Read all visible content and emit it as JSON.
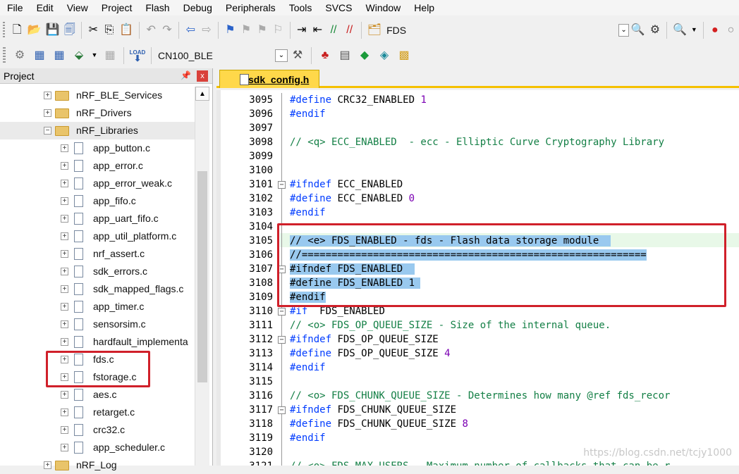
{
  "menu": [
    "File",
    "Edit",
    "View",
    "Project",
    "Flash",
    "Debug",
    "Peripherals",
    "Tools",
    "SVCS",
    "Window",
    "Help"
  ],
  "toolbar1": {
    "icons": [
      "new-file-icon",
      "open-file-icon",
      "save-icon",
      "save-all-icon",
      "cut-icon",
      "copy-icon",
      "paste-icon",
      "undo-icon",
      "redo-icon",
      "back-icon",
      "forward-icon",
      "bookmark-icon",
      "prev-bookmark-icon",
      "next-bookmark-icon",
      "clear-bookmarks-icon",
      "indent-icon",
      "unindent-icon",
      "comment-icon",
      "uncomment-icon",
      "find-in-files-icon"
    ],
    "find_text": "FDS",
    "right_icons": [
      "dropdown-icon",
      "browse-icon",
      "debug-session-icon",
      "zoom-icon",
      "breakpoint-icon",
      "stop-icon"
    ]
  },
  "toolbar2": {
    "target": "CN100_BLE",
    "load_label": "LOAD"
  },
  "project_panel": {
    "title": "Project",
    "pin": "\u0004",
    "close": "x",
    "items": [
      {
        "label": "nRF_BLE_Services",
        "kind": "folder",
        "exp": "+"
      },
      {
        "label": "nRF_Drivers",
        "kind": "folder",
        "exp": "+"
      },
      {
        "label": "nRF_Libraries",
        "kind": "folder",
        "exp": "−"
      },
      {
        "label": "app_button.c",
        "kind": "file",
        "exp": "+"
      },
      {
        "label": "app_error.c",
        "kind": "file",
        "exp": "+"
      },
      {
        "label": "app_error_weak.c",
        "kind": "file",
        "exp": "+"
      },
      {
        "label": "app_fifo.c",
        "kind": "file",
        "exp": "+"
      },
      {
        "label": "app_uart_fifo.c",
        "kind": "file",
        "exp": "+"
      },
      {
        "label": "app_util_platform.c",
        "kind": "file",
        "exp": "+"
      },
      {
        "label": "nrf_assert.c",
        "kind": "file",
        "exp": "+"
      },
      {
        "label": "sdk_errors.c",
        "kind": "file",
        "exp": "+"
      },
      {
        "label": "sdk_mapped_flags.c",
        "kind": "file",
        "exp": "+"
      },
      {
        "label": "app_timer.c",
        "kind": "file",
        "exp": "+"
      },
      {
        "label": "sensorsim.c",
        "kind": "file",
        "exp": "+"
      },
      {
        "label": "hardfault_implementa",
        "kind": "file",
        "exp": "+"
      },
      {
        "label": "fds.c",
        "kind": "file",
        "exp": "+"
      },
      {
        "label": "fstorage.c",
        "kind": "file",
        "exp": "+"
      },
      {
        "label": "aes.c",
        "kind": "file",
        "exp": "+"
      },
      {
        "label": "retarget.c",
        "kind": "file",
        "exp": "+"
      },
      {
        "label": "crc32.c",
        "kind": "file",
        "exp": "+"
      },
      {
        "label": "app_scheduler.c",
        "kind": "file",
        "exp": "+"
      },
      {
        "label": "nRF_Log",
        "kind": "folder",
        "exp": "+"
      }
    ]
  },
  "editor": {
    "tab": "sdk_config.h",
    "lines": [
      {
        "n": "3095",
        "code": [
          [
            "pp",
            "#define "
          ],
          [
            "id",
            "CRC32_ENABLED "
          ],
          [
            "nm",
            "1"
          ]
        ]
      },
      {
        "n": "3096",
        "code": [
          [
            "pp",
            "#endif"
          ]
        ]
      },
      {
        "n": "3097",
        "code": []
      },
      {
        "n": "3098",
        "code": [
          [
            "cm",
            "// <q> ECC_ENABLED  - ecc - Elliptic Curve Cryptography Library"
          ]
        ]
      },
      {
        "n": "3099",
        "code": []
      },
      {
        "n": "3100",
        "code": []
      },
      {
        "n": "3101",
        "fold": "−",
        "code": [
          [
            "pp",
            "#ifndef "
          ],
          [
            "id",
            "ECC_ENABLED"
          ]
        ]
      },
      {
        "n": "3102",
        "code": [
          [
            "pp",
            "#define "
          ],
          [
            "id",
            "ECC_ENABLED "
          ],
          [
            "nm",
            "0"
          ]
        ]
      },
      {
        "n": "3103",
        "code": [
          [
            "pp",
            "#endif"
          ]
        ]
      },
      {
        "n": "3104",
        "code": []
      },
      {
        "n": "3105",
        "hl": true,
        "code": [
          [
            "cm",
            "// <e> FDS_ENABLED - fds - Flash data storage module  "
          ]
        ]
      },
      {
        "n": "3106",
        "hl": true,
        "code": [
          [
            "cm",
            "//=========================================================="
          ]
        ]
      },
      {
        "n": "3107",
        "hl": true,
        "fold": "−",
        "code": [
          [
            "pp",
            "#ifndef "
          ],
          [
            "id",
            "FDS_ENABLED  "
          ]
        ]
      },
      {
        "n": "3108",
        "hl": true,
        "code": [
          [
            "pp",
            "#define "
          ],
          [
            "id",
            "FDS_ENABLED 1 "
          ]
        ]
      },
      {
        "n": "3109",
        "hl": true,
        "code": [
          [
            "pp",
            "#endif"
          ]
        ]
      },
      {
        "n": "3110",
        "fold": "−",
        "code": [
          [
            "pp",
            "#if  "
          ],
          [
            "id",
            "FDS_ENABLED"
          ]
        ]
      },
      {
        "n": "3111",
        "code": [
          [
            "cm",
            "// <o> FDS_OP_QUEUE_SIZE - Size of the internal queue."
          ]
        ]
      },
      {
        "n": "3112",
        "fold": "−",
        "code": [
          [
            "pp",
            "#ifndef "
          ],
          [
            "id",
            "FDS_OP_QUEUE_SIZE"
          ]
        ]
      },
      {
        "n": "3113",
        "code": [
          [
            "pp",
            "#define "
          ],
          [
            "id",
            "FDS_OP_QUEUE_SIZE "
          ],
          [
            "nm",
            "4"
          ]
        ]
      },
      {
        "n": "3114",
        "code": [
          [
            "pp",
            "#endif"
          ]
        ]
      },
      {
        "n": "3115",
        "code": []
      },
      {
        "n": "3116",
        "code": [
          [
            "cm",
            "// <o> FDS_CHUNK_QUEUE_SIZE - Determines how many @ref fds_recor"
          ]
        ]
      },
      {
        "n": "3117",
        "fold": "−",
        "code": [
          [
            "pp",
            "#ifndef "
          ],
          [
            "id",
            "FDS_CHUNK_QUEUE_SIZE"
          ]
        ]
      },
      {
        "n": "3118",
        "code": [
          [
            "pp",
            "#define "
          ],
          [
            "id",
            "FDS_CHUNK_QUEUE_SIZE "
          ],
          [
            "nm",
            "8"
          ]
        ]
      },
      {
        "n": "3119",
        "code": [
          [
            "pp",
            "#endif"
          ]
        ]
      },
      {
        "n": "3120",
        "code": []
      },
      {
        "n": "3121",
        "code": [
          [
            "cm",
            "// <o> FDS_MAX_USERS - Maximum number of callbacks that can be r"
          ]
        ]
      }
    ]
  },
  "watermark": "https://blog.csdn.net/tcjy1000",
  "colors": {
    "highlight": "#99c9ef",
    "annotation": "#d0202a",
    "tab": "#ffd84a"
  }
}
